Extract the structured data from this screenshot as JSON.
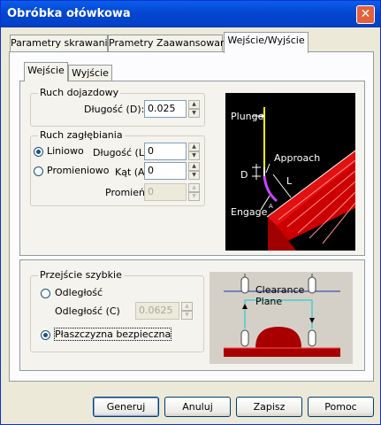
{
  "window": {
    "title": "Obróbka ołówkowa",
    "close_label": "✕"
  },
  "tabs": [
    {
      "label": "Parametry skrawania"
    },
    {
      "label": "Prametry Zaawansowane"
    },
    {
      "label": "Wejście/Wyjście"
    }
  ],
  "subtabs": [
    {
      "label": "Wejście"
    },
    {
      "label": "Wyjście"
    }
  ],
  "ruch_dojazdowy": {
    "legend": "Ruch dojazdowy",
    "dlugosc_label": "Długość (D):",
    "dlugosc_value": "0.025"
  },
  "ruch_zaglebiania": {
    "legend": "Ruch zagłębiania",
    "liniowo_label": "Liniowo",
    "promieniowo_label": "Promieniowo",
    "dlugosc_label": "Długość (L)",
    "dlugosc_value": "0",
    "kat_label": "Kąt (A)",
    "kat_value": "0",
    "promien_label": "Promień (R)",
    "promien_value": "0",
    "selected": "Liniowo"
  },
  "diagram1": {
    "plunge": "Plunge",
    "approach": "Approach",
    "engage": "Engage",
    "d": "D",
    "l": "L",
    "a": "A"
  },
  "przejscie": {
    "legend": "Przejście szybkie",
    "odleglosc_radio": "Odległość",
    "odleglosc_label": "Odległość (C)",
    "odleglosc_value": "0.0625",
    "plaszczyzna_radio": "Płaszczyzna bezpieczna",
    "selected": "Płaszczyzna bezpieczna"
  },
  "diagram2": {
    "line1": "Clearance",
    "line2": "Plane"
  },
  "buttons": {
    "generuj": "Generuj",
    "anuluj": "Anuluj",
    "zapisz": "Zapisz",
    "pomoc": "Pomoc"
  },
  "colors": {
    "titlebar": "#0054e3",
    "diagram_bg": "#000000",
    "part_red": "#cc0000",
    "plunge_line": "#ffff00",
    "engage_arc": "#cc44ff",
    "clearance_line": "#00cccc"
  }
}
